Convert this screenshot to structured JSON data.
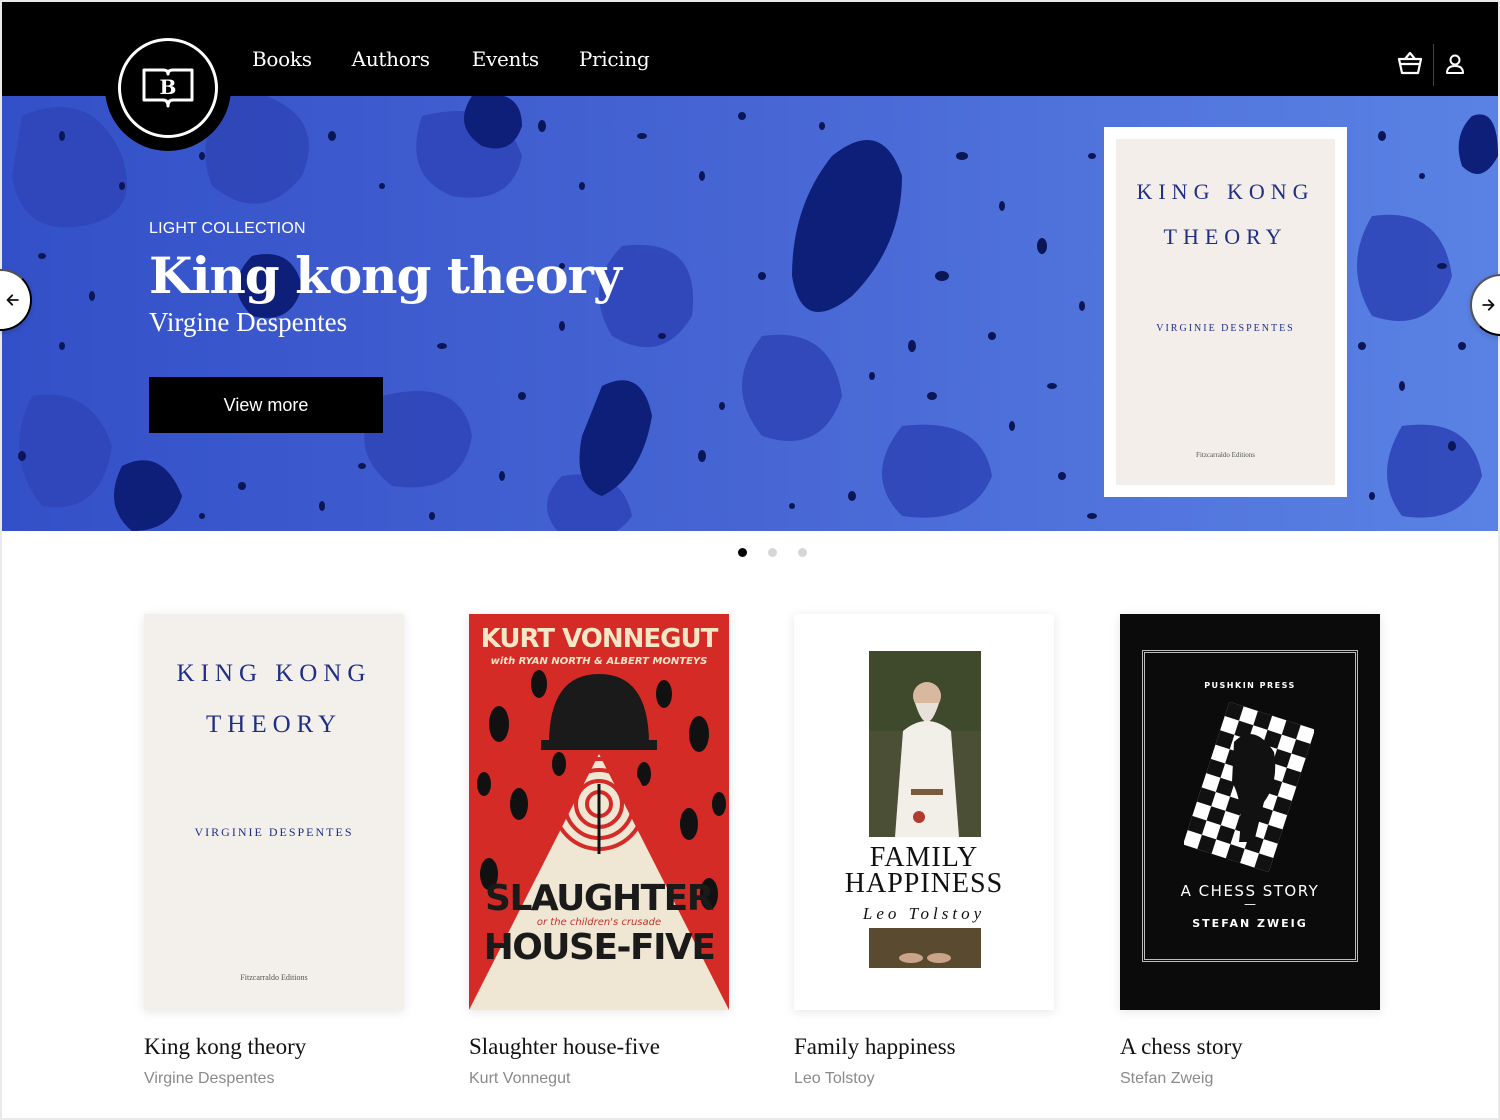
{
  "nav": {
    "logo_letter": "B",
    "items": [
      {
        "label": "Books"
      },
      {
        "label": "Authors"
      },
      {
        "label": "Events"
      },
      {
        "label": "Pricing"
      }
    ],
    "icons": [
      "basket-icon",
      "user-icon"
    ]
  },
  "hero": {
    "eyebrow": "LIGHT COLLECTION",
    "title": "King kong theory",
    "author": "Virgine Despentes",
    "button_label": "View more",
    "cover": {
      "title_line1": "KING KONG",
      "title_line2": "THEORY",
      "author": "VIRGINIE DESPENTES",
      "publisher": "Fitzcarraldo Editions"
    },
    "active_slide": 1,
    "slide_count": 3
  },
  "books": [
    {
      "title": "King kong theory",
      "author": "Virgine Despentes",
      "cover": {
        "line1": "KING KONG",
        "line2": "THEORY",
        "author": "VIRGINIE DESPENTES",
        "publisher": "Fitzcarraldo Editions"
      }
    },
    {
      "title": "Slaughter house-five",
      "author": "Kurt Vonnegut",
      "cover": {
        "top": "KURT VONNEGUT",
        "sub": "with RYAN NORTH & ALBERT MONTEYS",
        "line1": "SLAUGHTER",
        "tag": "or the children's crusade",
        "line2": "HOUSE-FIVE"
      }
    },
    {
      "title": "Family happiness",
      "author": "Leo Tolstoy",
      "cover": {
        "line1": "FAMILY",
        "line2": "HAPPINESS",
        "author": "Leo Tolstoy"
      }
    },
    {
      "title": "A chess story",
      "author": "Stefan Zweig",
      "cover": {
        "publisher": "PUSHKIN PRESS",
        "title": "A CHESS STORY",
        "dash": "—",
        "author": "STEFAN ZWEIG"
      }
    }
  ],
  "colors": {
    "hero_blue": "#3e61d0",
    "navy": "#1f2f86",
    "vonnegut_red": "#d42b27"
  }
}
